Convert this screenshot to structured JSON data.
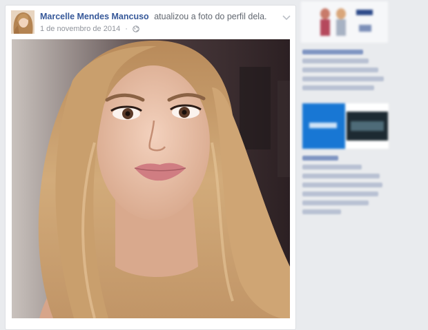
{
  "post": {
    "author_name": "Marcelle Mendes Mancuso",
    "action_text": "atualizou a foto do perfil dela.",
    "date": "1 de novembro de 2014",
    "separator": "·",
    "privacy_icon": "globe-icon",
    "menu_icon": "chevron-down-icon"
  },
  "colors": {
    "page_bg": "#e9ebee",
    "card_bg": "#ffffff",
    "author_link": "#365899",
    "meta_text": "#90949c"
  }
}
